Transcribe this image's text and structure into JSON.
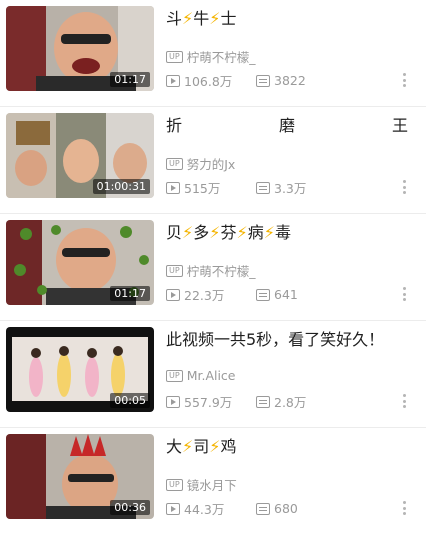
{
  "videos": [
    {
      "title_parts": [
        "斗",
        "⚡",
        "牛",
        "⚡",
        "士"
      ],
      "uploader": "柠萌不柠檬_",
      "up_badge": "UP",
      "views": "106.8万",
      "danmaku": "3822",
      "duration": "01:17"
    },
    {
      "title_parts": [
        "折",
        "磨",
        "王"
      ],
      "uploader": "努力的Jx",
      "up_badge": "UP",
      "views": "515万",
      "danmaku": "3.3万",
      "duration": "01:00:31"
    },
    {
      "title_parts": [
        "贝",
        "⚡",
        "多",
        "⚡",
        "芬",
        "⚡",
        "病",
        "⚡",
        "毒"
      ],
      "uploader": "柠萌不柠檬_",
      "up_badge": "UP",
      "views": "22.3万",
      "danmaku": "641",
      "duration": "01:17"
    },
    {
      "title_parts": [
        "此视频一共5秒，看了笑好久！"
      ],
      "uploader": "Mr.Alice",
      "up_badge": "UP",
      "views": "557.9万",
      "danmaku": "2.8万",
      "duration": "00:05"
    },
    {
      "title_parts": [
        "大",
        "⚡",
        "司",
        "⚡",
        "鸡"
      ],
      "uploader": "镜水月下",
      "up_badge": "UP",
      "views": "44.3万",
      "danmaku": "680",
      "duration": "00:36"
    }
  ],
  "colors": {
    "bolt": "#f4b400",
    "meta": "#9a9a9a",
    "title": "#212121"
  }
}
